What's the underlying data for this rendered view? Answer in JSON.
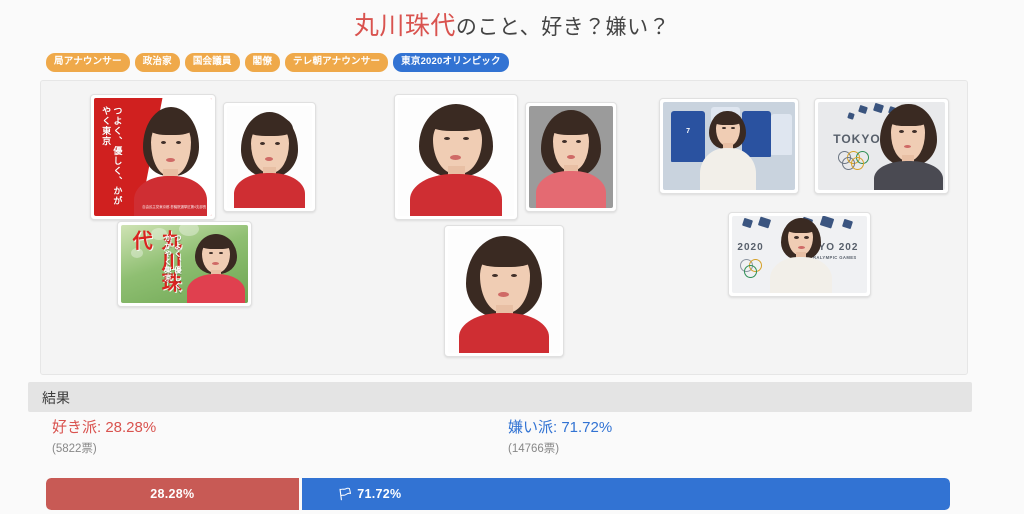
{
  "page": {
    "title_name": "丸川珠代",
    "title_rest": "のこと、好き？嫌い？"
  },
  "tags": [
    {
      "label": "局アナウンサー",
      "color": "#efa94a"
    },
    {
      "label": "政治家",
      "color": "#efa94a"
    },
    {
      "label": "国会議員",
      "color": "#efa94a"
    },
    {
      "label": "閣僚",
      "color": "#efa94a"
    },
    {
      "label": "テレ朝アナウンサー",
      "color": "#efa94a"
    },
    {
      "label": "東京2020オリンピック",
      "color": "#3273d3"
    }
  ],
  "gallery": {
    "photos": [
      {
        "name": "campaign-poster-red",
        "caption_vertical": "つよく、優しく、かがやく東京",
        "credit": "自由民主党東京都\n参議院選挙区第4支部長"
      },
      {
        "name": "portrait-red-suit-white-bg",
        "caption_vertical": ""
      },
      {
        "name": "portrait-red-jacket-smiling",
        "caption_vertical": ""
      },
      {
        "name": "portrait-red-jacket-gray-bg",
        "caption_vertical": ""
      },
      {
        "name": "photo-announcer-jerseys",
        "jersey_number": "7"
      },
      {
        "name": "photo-tokyo-olympic-backdrop",
        "backdrop_text": "TOKYO"
      },
      {
        "name": "campaign-poster-green",
        "name_vertical": "丸川珠代",
        "caption_vertical": "つよく、優しく、かがやく東京"
      },
      {
        "name": "portrait-red-jacket-center",
        "caption_vertical": ""
      },
      {
        "name": "photo-paralympic-backdrop",
        "backdrop_year": "2020",
        "backdrop_text": "KYO 202",
        "backdrop_sub": "RALYMPIC GAMES"
      }
    ]
  },
  "result": {
    "header": "結果",
    "like": {
      "label": "好き派: 28.28%",
      "votes": "(5822票)",
      "percent": 28.28,
      "bar_label": "28.28%",
      "color": "#d9534f",
      "bar_color": "#c85a55"
    },
    "dislike": {
      "label": "嫌い派: 71.72%",
      "votes": "(14766票)",
      "percent": 71.72,
      "bar_label": "71.72%",
      "flag_icon": "🏳",
      "color": "#3273d3",
      "bar_color": "#3273d3"
    }
  }
}
